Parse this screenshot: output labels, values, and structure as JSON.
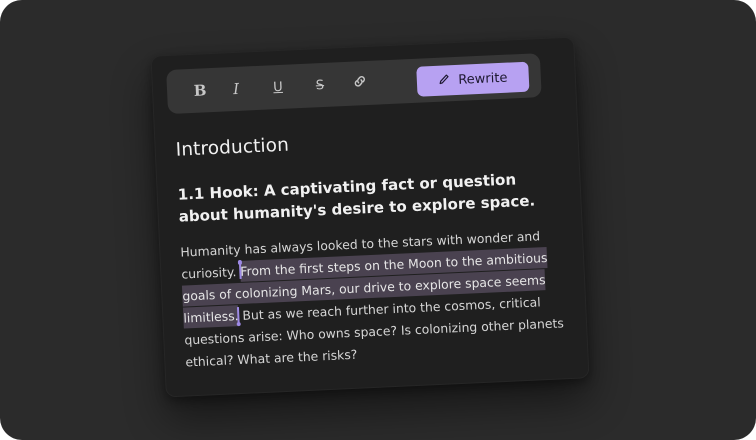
{
  "toolbar": {
    "bold_label": "B",
    "italic_label": "I",
    "underline_label": "U",
    "strike_label": "S",
    "link_icon": "link-icon",
    "rewrite_icon": "pencil-icon",
    "rewrite_label": "Rewrite"
  },
  "document": {
    "heading": "Introduction",
    "subheading": "1.1 Hook: A captivating fact or question about humanity's desire to explore space.",
    "paragraph": {
      "before": "Humanity has always looked to the stars with wonder and curiosity.",
      "selected": "From the first steps on the Moon to the ambitious goals of colonizing Mars, our drive to explore space seems limitless.",
      "after": "But as we reach further into the cosmos, critical questions arise: Who owns space? Is colonizing other planets ethical? What are the risks?"
    }
  },
  "colors": {
    "accent": "#b7a1f2",
    "selection": "#4a4250",
    "background": "#2b2b2b",
    "card": "#1f1f1f"
  }
}
